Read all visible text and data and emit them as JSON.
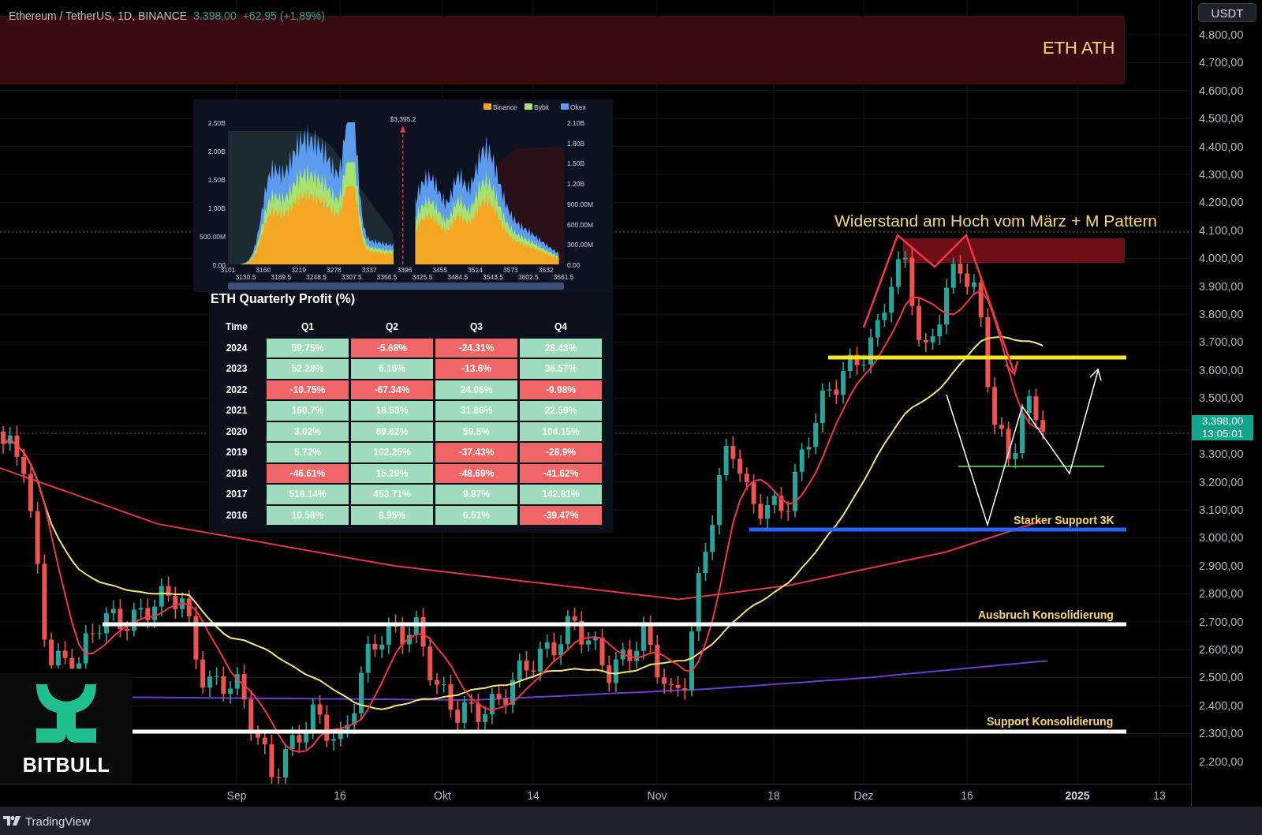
{
  "header": {
    "symbol": "Ethereum / TetherUS, 1D, BINANCE",
    "price": "3.398,00",
    "change": "+62,95 (+1,89%)"
  },
  "currency_button": "USDT",
  "price_axis": {
    "ticks": [
      "4.800,00",
      "4.700,00",
      "4.600,00",
      "4.500,00",
      "4.400,00",
      "4.300,00",
      "4.200,00",
      "4.100,00",
      "4.000,00",
      "3.900,00",
      "3.800,00",
      "3.700,00",
      "3.600,00",
      "3.500,00",
      "3.300,00",
      "3.200,00",
      "3.100,00",
      "3.000,00",
      "2.900,00",
      "2.800,00",
      "2.700,00",
      "2.600,00",
      "2.500,00",
      "2.400,00",
      "2.300,00",
      "2.200,00"
    ],
    "current_price": "3.398,00",
    "countdown": "13:05:01"
  },
  "time_axis": [
    {
      "label": "Sep",
      "kind": "month"
    },
    {
      "label": "16",
      "kind": "day"
    },
    {
      "label": "Okt",
      "kind": "month"
    },
    {
      "label": "14",
      "kind": "day"
    },
    {
      "label": "Nov",
      "kind": "month"
    },
    {
      "label": "18",
      "kind": "day"
    },
    {
      "label": "Dez",
      "kind": "month"
    },
    {
      "label": "16",
      "kind": "day"
    },
    {
      "label": "2025",
      "kind": "year"
    },
    {
      "label": "13",
      "kind": "day"
    }
  ],
  "annotations": [
    {
      "label": "ETH ATH",
      "kind": "zone"
    },
    {
      "label": "Widerstand am Hoch vom März + M Pattern",
      "kind": "title"
    },
    {
      "label": "Starker Support 3K",
      "kind": "line"
    },
    {
      "label": "Ausbruch Konsolidierung",
      "kind": "line"
    },
    {
      "label": "Support Konsolidierung",
      "kind": "line"
    }
  ],
  "liquidation_map": {
    "legend": [
      {
        "name": "Binance",
        "color": "#f5a623"
      },
      {
        "name": "Bybit",
        "color": "#a6e36e"
      },
      {
        "name": "Okex",
        "color": "#5b9bf0"
      }
    ],
    "marker_label": "$3,395.2",
    "left_axis": [
      "2.50B",
      "2.00B",
      "1.50B",
      "1.00B",
      "500.00M",
      "0.00"
    ],
    "right_axis": [
      "2.10B",
      "1.80B",
      "1.50B",
      "1.20B",
      "900.00M",
      "600.00M",
      "300.00M",
      "0.00"
    ],
    "x_ticks": [
      "3101",
      "3130.5",
      "3160",
      "3189.5",
      "3219",
      "3248.5",
      "3278",
      "3307.5",
      "3337",
      "3366.5",
      "3396",
      "3425.5",
      "3455",
      "3484.5",
      "3514",
      "3543.5",
      "3573",
      "3602.5",
      "3632",
      "3661.5"
    ]
  },
  "profit_table": {
    "title": "ETH Quarterly Profit (%)",
    "columns": [
      "Time",
      "Q1",
      "Q2",
      "Q3",
      "Q4"
    ],
    "rows": [
      {
        "cells": [
          {
            "value": "2024",
            "kind": "year"
          },
          {
            "value": "59.75%",
            "color": "#9fdcbd"
          },
          {
            "value": "-5.68%",
            "color": "#f06666"
          },
          {
            "value": "-24.31%",
            "color": "#f06666"
          },
          {
            "value": "28.43%",
            "color": "#9fdcbd"
          }
        ]
      },
      {
        "cells": [
          {
            "value": "2023",
            "kind": "year"
          },
          {
            "value": "52.28%",
            "color": "#9fdcbd"
          },
          {
            "value": "6.16%",
            "color": "#9fdcbd"
          },
          {
            "value": "-13.6%",
            "color": "#f06666"
          },
          {
            "value": "36.57%",
            "color": "#9fdcbd"
          }
        ]
      },
      {
        "cells": [
          {
            "value": "2022",
            "kind": "year"
          },
          {
            "value": "-10.75%",
            "color": "#f06666"
          },
          {
            "value": "-67.34%",
            "color": "#f06666"
          },
          {
            "value": "24.06%",
            "color": "#9fdcbd"
          },
          {
            "value": "-9.98%",
            "color": "#f06666"
          }
        ]
      },
      {
        "cells": [
          {
            "value": "2021",
            "kind": "year"
          },
          {
            "value": "160.7%",
            "color": "#9fdcbd"
          },
          {
            "value": "18.53%",
            "color": "#9fdcbd"
          },
          {
            "value": "31.86%",
            "color": "#9fdcbd"
          },
          {
            "value": "22.59%",
            "color": "#9fdcbd"
          }
        ]
      },
      {
        "cells": [
          {
            "value": "2020",
            "kind": "year"
          },
          {
            "value": "3.02%",
            "color": "#9fdcbd"
          },
          {
            "value": "69.62%",
            "color": "#9fdcbd"
          },
          {
            "value": "59.5%",
            "color": "#9fdcbd"
          },
          {
            "value": "104.15%",
            "color": "#9fdcbd"
          }
        ]
      },
      {
        "cells": [
          {
            "value": "2019",
            "kind": "year"
          },
          {
            "value": "5.72%",
            "color": "#9fdcbd"
          },
          {
            "value": "102.25%",
            "color": "#9fdcbd"
          },
          {
            "value": "-37.43%",
            "color": "#f06666"
          },
          {
            "value": "-28.9%",
            "color": "#f06666"
          }
        ]
      },
      {
        "cells": [
          {
            "value": "2018",
            "kind": "year"
          },
          {
            "value": "-46.61%",
            "color": "#f06666"
          },
          {
            "value": "15.29%",
            "color": "#9fdcbd"
          },
          {
            "value": "-48.69%",
            "color": "#f06666"
          },
          {
            "value": "-41.62%",
            "color": "#f06666"
          }
        ]
      },
      {
        "cells": [
          {
            "value": "2017",
            "kind": "year"
          },
          {
            "value": "518.14%",
            "color": "#9fdcbd"
          },
          {
            "value": "453.71%",
            "color": "#9fdcbd"
          },
          {
            "value": "9.87%",
            "color": "#9fdcbd"
          },
          {
            "value": "142.81%",
            "color": "#9fdcbd"
          }
        ]
      },
      {
        "cells": [
          {
            "value": "2016",
            "kind": "year"
          },
          {
            "value": "10.58%",
            "color": "#9fdcbd"
          },
          {
            "value": "8.95%",
            "color": "#9fdcbd"
          },
          {
            "value": "6.51%",
            "color": "#9fdcbd"
          },
          {
            "value": "-39.47%",
            "color": "#f06666"
          }
        ]
      }
    ]
  },
  "logo": {
    "name": "BITBULL"
  },
  "footer": {
    "brand": "TradingView"
  }
}
